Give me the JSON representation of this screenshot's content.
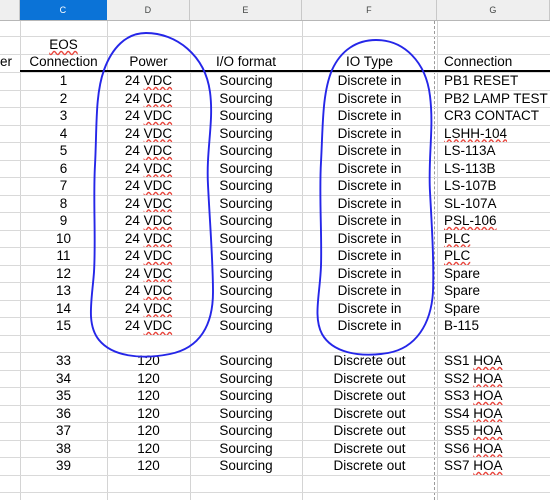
{
  "app": {
    "type": "spreadsheet",
    "selected_column": "C"
  },
  "column_headers": [
    {
      "label": "C",
      "selected": true
    },
    {
      "label": "D",
      "selected": false
    },
    {
      "label": "E",
      "selected": false
    },
    {
      "label": "F",
      "selected": false
    },
    {
      "label": "G",
      "selected": false
    }
  ],
  "partial_left_column": {
    "header_text_fragment": "er"
  },
  "table": {
    "headers": {
      "c_line1": "EOS",
      "c_line2": "Connection",
      "d": "Power",
      "e": "I/O format",
      "f": "IO Type",
      "g": "Connection"
    },
    "rows": [
      {
        "eos": "1",
        "power": "24 VDC",
        "io_format": "Sourcing",
        "io_type": "Discrete in",
        "connection": "PB1 RESET"
      },
      {
        "eos": "2",
        "power": "24 VDC",
        "io_format": "Sourcing",
        "io_type": "Discrete in",
        "connection": "PB2 LAMP TEST"
      },
      {
        "eos": "3",
        "power": "24 VDC",
        "io_format": "Sourcing",
        "io_type": "Discrete in",
        "connection": "CR3 CONTACT"
      },
      {
        "eos": "4",
        "power": "24 VDC",
        "io_format": "Sourcing",
        "io_type": "Discrete in",
        "connection": "LSHH-104"
      },
      {
        "eos": "5",
        "power": "24 VDC",
        "io_format": "Sourcing",
        "io_type": "Discrete in",
        "connection": "LS-113A"
      },
      {
        "eos": "6",
        "power": "24 VDC",
        "io_format": "Sourcing",
        "io_type": "Discrete in",
        "connection": "LS-113B"
      },
      {
        "eos": "7",
        "power": "24 VDC",
        "io_format": "Sourcing",
        "io_type": "Discrete in",
        "connection": "LS-107B"
      },
      {
        "eos": "8",
        "power": "24 VDC",
        "io_format": "Sourcing",
        "io_type": "Discrete in",
        "connection": "SL-107A"
      },
      {
        "eos": "9",
        "power": "24 VDC",
        "io_format": "Sourcing",
        "io_type": "Discrete in",
        "connection": "PSL-106"
      },
      {
        "eos": "10",
        "power": "24 VDC",
        "io_format": "Sourcing",
        "io_type": "Discrete in",
        "connection": "PLC"
      },
      {
        "eos": "11",
        "power": "24 VDC",
        "io_format": "Sourcing",
        "io_type": "Discrete in",
        "connection": "PLC"
      },
      {
        "eos": "12",
        "power": "24 VDC",
        "io_format": "Sourcing",
        "io_type": "Discrete in",
        "connection": "Spare"
      },
      {
        "eos": "13",
        "power": "24 VDC",
        "io_format": "Sourcing",
        "io_type": "Discrete in",
        "connection": "Spare"
      },
      {
        "eos": "14",
        "power": "24 VDC",
        "io_format": "Sourcing",
        "io_type": "Discrete in",
        "connection": "Spare"
      },
      {
        "eos": "15",
        "power": "24 VDC",
        "io_format": "Sourcing",
        "io_type": "Discrete in",
        "connection": "B-115"
      },
      {
        "eos": "",
        "power": "",
        "io_format": "",
        "io_type": "",
        "connection": ""
      },
      {
        "eos": "33",
        "power": "120",
        "io_format": "Sourcing",
        "io_type": "Discrete out",
        "connection": "SS1 HOA"
      },
      {
        "eos": "34",
        "power": "120",
        "io_format": "Sourcing",
        "io_type": "Discrete out",
        "connection": "SS2 HOA"
      },
      {
        "eos": "35",
        "power": "120",
        "io_format": "Sourcing",
        "io_type": "Discrete out",
        "connection": "SS3 HOA"
      },
      {
        "eos": "36",
        "power": "120",
        "io_format": "Sourcing",
        "io_type": "Discrete out",
        "connection": "SS4 HOA"
      },
      {
        "eos": "37",
        "power": "120",
        "io_format": "Sourcing",
        "io_type": "Discrete out",
        "connection": "SS5 HOA"
      },
      {
        "eos": "38",
        "power": "120",
        "io_format": "Sourcing",
        "io_type": "Discrete out",
        "connection": "SS6 HOA"
      },
      {
        "eos": "39",
        "power": "120",
        "io_format": "Sourcing",
        "io_type": "Discrete out",
        "connection": "SS7 HOA"
      }
    ]
  },
  "annotations": {
    "color": "#2526e8",
    "shapes": [
      {
        "name": "power-column-circle",
        "target_column": "D",
        "target_header": "Power"
      },
      {
        "name": "io-type-column-circle",
        "target_column": "F",
        "target_header": "IO Type"
      }
    ]
  },
  "spellcheck_underlined_terms": [
    "EOS",
    "VDC",
    "LSHH",
    "SL",
    "PSL",
    "PLC",
    "HOA"
  ],
  "colors": {
    "selected_header_bg": "#0b73d7",
    "header_bg": "#efefef",
    "gridline": "#d9d9d9",
    "annotation_blue": "#2526e8",
    "spellcheck_red": "#e8453c",
    "text": "#000000"
  }
}
